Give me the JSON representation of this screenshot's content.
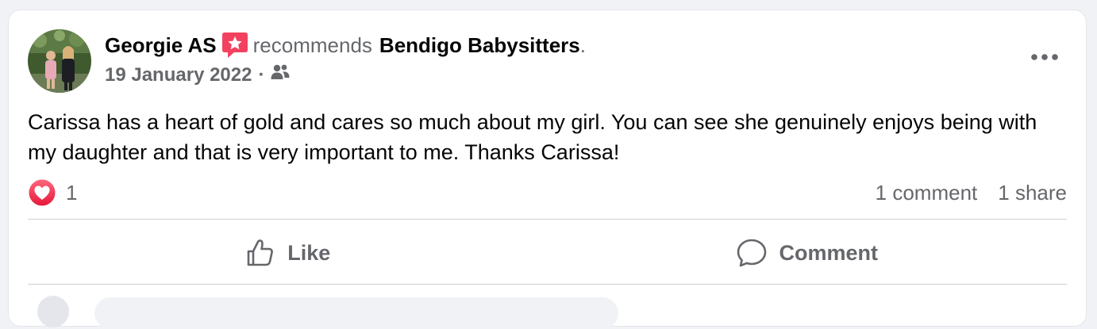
{
  "post": {
    "author": "Georgie AS",
    "verb": "recommends",
    "page_name": "Bendigo Babysitters",
    "page_suffix": ".",
    "date": "19 January 2022",
    "separator": "·",
    "audience_icon": "friends-icon",
    "badge_icon": "recommendation-star-icon",
    "body": "Carissa has a heart of gold and cares so much about my girl. You can see she genuinely enjoys being with my daughter and that is very important to me. Thanks Carissa!",
    "reaction_icon": "love-reaction-icon",
    "reaction_count": "1",
    "comments": "1 comment",
    "shares": "1 share"
  },
  "actions": {
    "like_label": "Like",
    "comment_label": "Comment"
  },
  "colors": {
    "badge": "#f3425f",
    "muted": "#65676b",
    "love": "#f33e58"
  }
}
